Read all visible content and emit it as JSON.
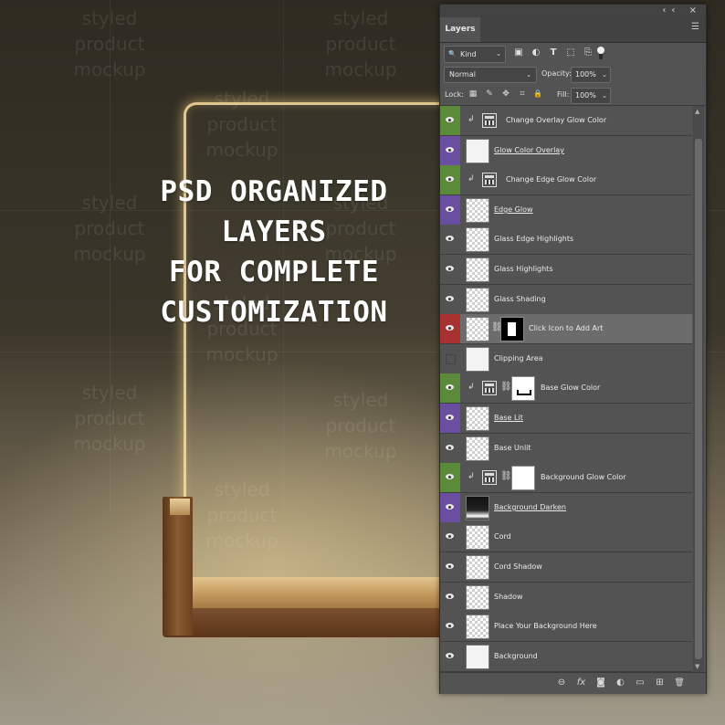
{
  "headline": [
    "PSD ORGANIZED LAYERS",
    "FOR COMPLETE",
    "CUSTOMIZATION"
  ],
  "watermark_lines": [
    "styled",
    "product",
    "mockup"
  ],
  "panel": {
    "collapse_glyph": "‹‹",
    "close_glyph": "×",
    "tab_label": "Layers",
    "menu_icon": "☰",
    "filter": {
      "search_glyph": "🔍",
      "kind_label": "Kind",
      "chevron": "⌄",
      "icons": [
        {
          "name": "pixel-filter-icon",
          "glyph": "▣"
        },
        {
          "name": "adjustment-filter-icon",
          "glyph": "◐"
        },
        {
          "name": "type-filter-icon",
          "glyph": "T"
        },
        {
          "name": "shape-filter-icon",
          "glyph": "⬚"
        },
        {
          "name": "smart-object-filter-icon",
          "glyph": "⎘"
        }
      ]
    },
    "blend_mode": "Normal",
    "opacity_label": "Opacity:",
    "opacity_value": "100%",
    "lock_label": "Lock:",
    "lock_icons": [
      {
        "name": "lock-transparent-icon",
        "glyph": "▦"
      },
      {
        "name": "lock-image-icon",
        "glyph": "✎"
      },
      {
        "name": "lock-position-icon",
        "glyph": "✥"
      },
      {
        "name": "lock-artboard-icon",
        "glyph": "⌗"
      },
      {
        "name": "lock-all-icon",
        "glyph": "🔒"
      }
    ],
    "fill_label": "Fill:",
    "fill_value": "100%",
    "layers": [
      {
        "name": "Change Overlay Glow Color",
        "color": "#5a8a3a",
        "visible": true,
        "clip": true,
        "kind": "adjustment",
        "mask": null,
        "underline": false,
        "selected": false
      },
      {
        "name": "Glow Color Overlay",
        "color": "#6a4fa0",
        "visible": true,
        "clip": false,
        "kind": "white",
        "mask": null,
        "underline": true,
        "selected": false
      },
      {
        "name": "Change Edge Glow Color",
        "color": "#5a8a3a",
        "visible": true,
        "clip": true,
        "kind": "adjustment",
        "mask": null,
        "underline": false,
        "selected": false
      },
      {
        "name": "Edge Glow",
        "color": "#6a4fa0",
        "visible": true,
        "clip": false,
        "kind": "checker",
        "mask": null,
        "underline": true,
        "selected": false
      },
      {
        "name": "Glass Edge Highlights",
        "color": null,
        "visible": true,
        "clip": false,
        "kind": "checker",
        "mask": null,
        "underline": false,
        "selected": false
      },
      {
        "name": "Glass Highlights",
        "color": null,
        "visible": true,
        "clip": false,
        "kind": "checker",
        "mask": null,
        "underline": false,
        "selected": false
      },
      {
        "name": "Glass Shading",
        "color": null,
        "visible": true,
        "clip": false,
        "kind": "checker",
        "mask": null,
        "underline": false,
        "selected": false
      },
      {
        "name": "Click Icon to Add Art",
        "color": "#a83232",
        "visible": true,
        "clip": false,
        "kind": "checker",
        "mask": "black",
        "underline": false,
        "selected": true
      },
      {
        "name": "Clipping Area",
        "color": null,
        "visible": false,
        "clip": false,
        "kind": "white",
        "mask": null,
        "underline": false,
        "selected": false
      },
      {
        "name": "Base Glow Color",
        "color": "#5a8a3a",
        "visible": true,
        "clip": true,
        "kind": "adjustment",
        "mask": "bracket",
        "underline": false,
        "selected": false
      },
      {
        "name": "Base Lit",
        "color": "#6a4fa0",
        "visible": true,
        "clip": false,
        "kind": "checker",
        "mask": null,
        "underline": true,
        "selected": false
      },
      {
        "name": "Base Unlit",
        "color": null,
        "visible": true,
        "clip": false,
        "kind": "checker",
        "mask": null,
        "underline": false,
        "selected": false
      },
      {
        "name": "Background Glow Color",
        "color": "#5a8a3a",
        "visible": true,
        "clip": true,
        "kind": "adjustment",
        "mask": "white",
        "underline": false,
        "selected": false
      },
      {
        "name": "Background Darken",
        "color": "#6a4fa0",
        "visible": true,
        "clip": false,
        "kind": "dark",
        "mask": null,
        "underline": true,
        "selected": false
      },
      {
        "name": "Cord",
        "color": null,
        "visible": true,
        "clip": false,
        "kind": "checker",
        "mask": null,
        "underline": false,
        "selected": false
      },
      {
        "name": "Cord Shadow",
        "color": null,
        "visible": true,
        "clip": false,
        "kind": "checker",
        "mask": null,
        "underline": false,
        "selected": false
      },
      {
        "name": "Shadow",
        "color": null,
        "visible": true,
        "clip": false,
        "kind": "checker",
        "mask": null,
        "underline": false,
        "selected": false
      },
      {
        "name": "Place Your Background Here",
        "color": null,
        "visible": true,
        "clip": false,
        "kind": "checker",
        "mask": null,
        "underline": false,
        "selected": false
      },
      {
        "name": "Background",
        "color": null,
        "visible": true,
        "clip": false,
        "kind": "white",
        "mask": null,
        "underline": false,
        "selected": false
      }
    ],
    "bottom_icons": [
      {
        "name": "link-layers-icon",
        "glyph": "⊖"
      },
      {
        "name": "add-layer-style-icon",
        "glyph": "fx"
      },
      {
        "name": "add-mask-icon",
        "glyph": "◙"
      },
      {
        "name": "new-adjustment-layer-icon",
        "glyph": "◐"
      },
      {
        "name": "new-group-icon",
        "glyph": "▭"
      },
      {
        "name": "new-layer-icon",
        "glyph": "⊞"
      },
      {
        "name": "delete-layer-icon",
        "glyph": "🗑"
      }
    ]
  }
}
